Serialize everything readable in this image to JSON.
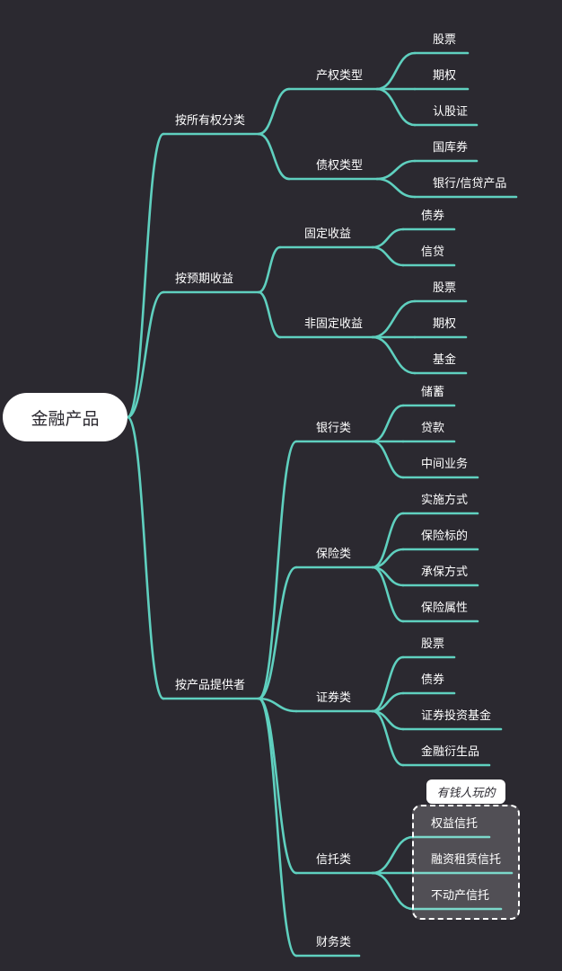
{
  "root": {
    "label": "金融产品"
  },
  "branches": [
    {
      "label": "按所有权分类",
      "children": [
        {
          "label": "产权类型",
          "children": [
            {
              "label": "股票"
            },
            {
              "label": "期权"
            },
            {
              "label": "认股证"
            }
          ]
        },
        {
          "label": "债权类型",
          "children": [
            {
              "label": "国库券"
            },
            {
              "label": "银行/信贷产品"
            }
          ]
        }
      ]
    },
    {
      "label": "按预期收益",
      "children": [
        {
          "label": "固定收益",
          "children": [
            {
              "label": "债券"
            },
            {
              "label": "信贷"
            }
          ]
        },
        {
          "label": "非固定收益",
          "children": [
            {
              "label": "股票"
            },
            {
              "label": "期权"
            },
            {
              "label": "基金"
            }
          ]
        }
      ]
    },
    {
      "label": "按产品提供者",
      "children": [
        {
          "label": "银行类",
          "children": [
            {
              "label": "储蓄"
            },
            {
              "label": "贷款"
            },
            {
              "label": "中间业务"
            }
          ]
        },
        {
          "label": "保险类",
          "children": [
            {
              "label": "实施方式"
            },
            {
              "label": "保险标的"
            },
            {
              "label": "承保方式"
            },
            {
              "label": "保险属性"
            }
          ]
        },
        {
          "label": "证券类",
          "children": [
            {
              "label": "股票"
            },
            {
              "label": "债券"
            },
            {
              "label": "证券投资基金"
            },
            {
              "label": "金融衍生品"
            }
          ]
        },
        {
          "label": "信托类",
          "children": [
            {
              "label": "权益信托"
            },
            {
              "label": "融资租赁信托"
            },
            {
              "label": "不动产信托"
            }
          ]
        },
        {
          "label": "财务类",
          "children": []
        }
      ]
    }
  ],
  "callout": {
    "label": "有钱人玩的"
  },
  "colors": {
    "background": "#2b2930",
    "line": "#5fd0bf",
    "text": "#ffffff",
    "root_fill": "#ffffff"
  }
}
